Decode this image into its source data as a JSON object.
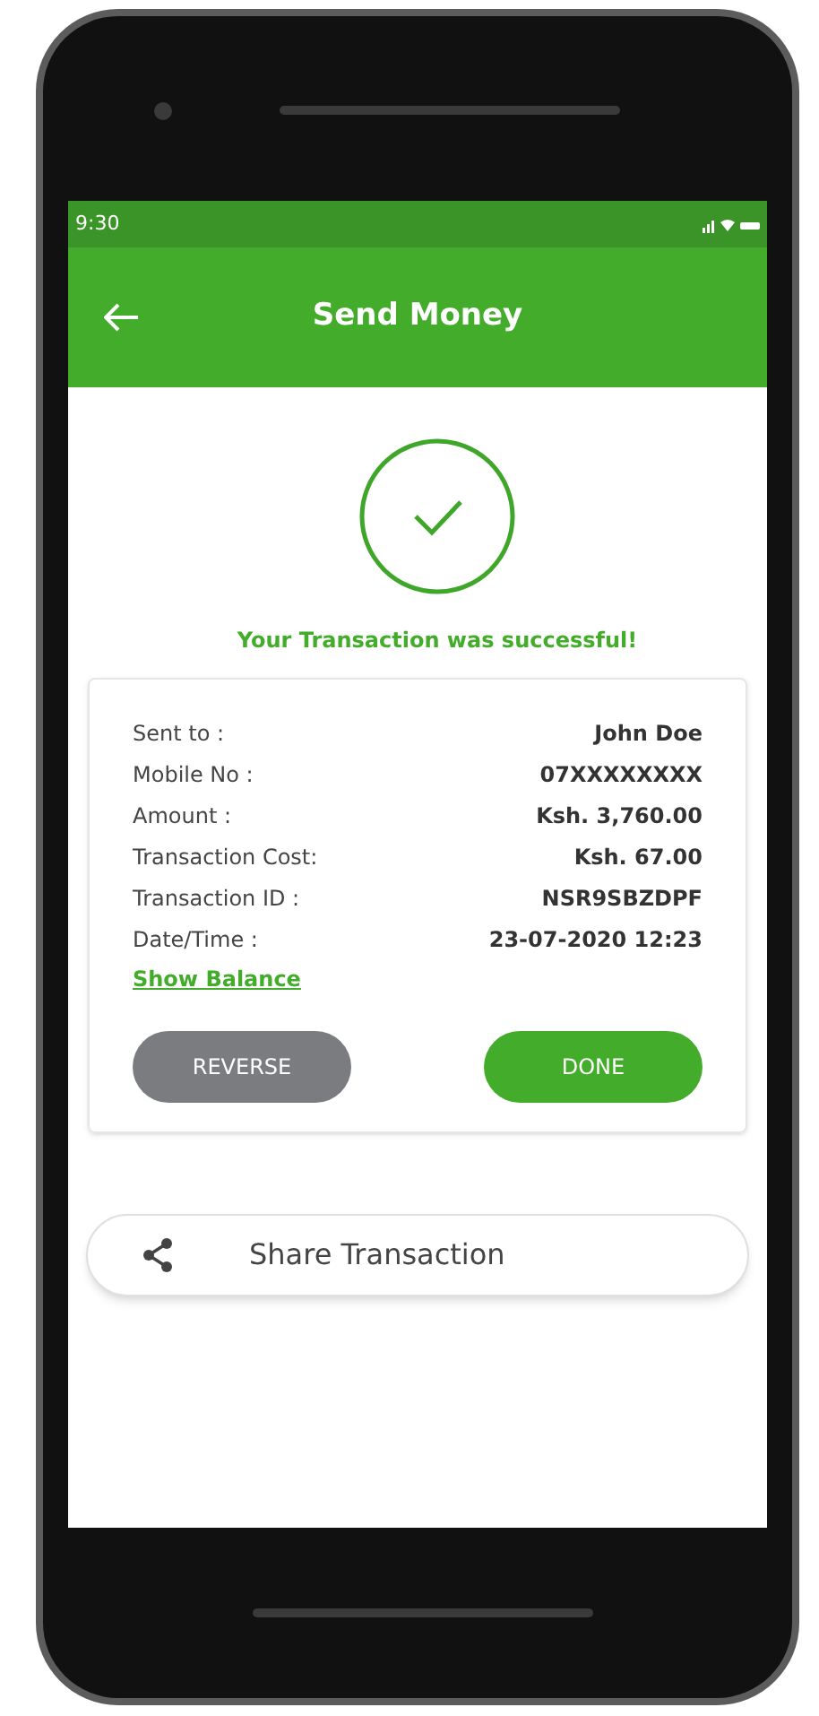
{
  "status_bar": {
    "time": "9:30"
  },
  "app_bar": {
    "title": "Send Money"
  },
  "message": "Your Transaction was successful!",
  "details": [
    {
      "label": "Sent to :",
      "value": "John Doe"
    },
    {
      "label": "Mobile No :",
      "value": "07XXXXXXXX"
    },
    {
      "label": "Amount :",
      "value": "Ksh. 3,760.00"
    },
    {
      "label": "Transaction Cost:",
      "value": "Ksh. 67.00"
    },
    {
      "label": "Transaction ID :",
      "value": "NSR9SBZDPF"
    },
    {
      "label": "Date/Time :",
      "value": "23-07-2020 12:23"
    }
  ],
  "link": "Show Balance",
  "buttons": [
    {
      "label": "REVERSE",
      "kind": "secondary"
    },
    {
      "label": "DONE",
      "kind": "primary"
    }
  ],
  "share": {
    "label": "Share Transaction"
  }
}
